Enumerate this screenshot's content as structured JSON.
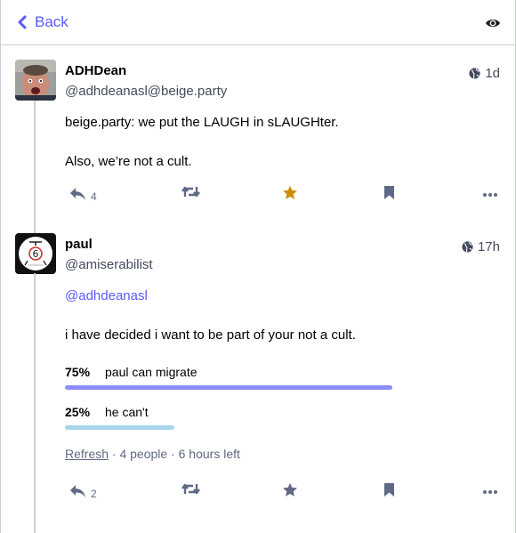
{
  "header": {
    "back_label": "Back"
  },
  "posts": [
    {
      "display_name": "ADHDean",
      "handle": "@adhdeanasl@beige.party",
      "time": "1d",
      "lines": [
        "beige.party: we put the LAUGH in sLAUGHter.",
        "Also, we’re not a cult."
      ],
      "reply_count": "4",
      "favourited": true
    },
    {
      "display_name": "paul",
      "handle": "@amiserabilist",
      "time": "17h",
      "mention": "@adhdeanasl",
      "line": "i have decided i want to be part of your not a cult.",
      "poll": {
        "options": [
          {
            "percent": "75%",
            "label": "paul can migrate",
            "fraction": 0.75,
            "color": "#8c8dff"
          },
          {
            "percent": "25%",
            "label": "he can't",
            "fraction": 0.25,
            "color": "#a6d4ea"
          }
        ],
        "refresh_label": "Refresh",
        "meta": "· 4 people · 6 hours left"
      },
      "reply_count": "2",
      "favourited": false
    }
  ],
  "colors": {
    "accent": "#595aff",
    "star_active": "#ca8f04",
    "icon": "#606984"
  }
}
